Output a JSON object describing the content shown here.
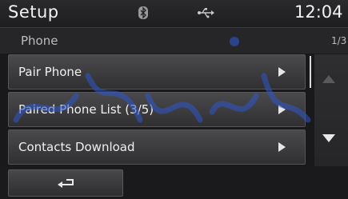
{
  "header": {
    "title": "Setup",
    "clock": "12:04",
    "bluetooth_icon": "bluetooth-icon",
    "usb_icon": "usb-icon"
  },
  "subheader": {
    "title": "Phone",
    "page_indicator": "1/3"
  },
  "menu": {
    "items": [
      {
        "label": "Pair Phone"
      },
      {
        "label": "Paired Phone List (3/5)"
      },
      {
        "label": "Contacts Download"
      }
    ]
  },
  "scroll": {
    "up_icon": "triangle-up-icon",
    "down_icon": "triangle-down-icon"
  },
  "footer": {
    "back_icon": "return-arrow-icon"
  },
  "colors": {
    "background": "#19191b",
    "button": "#3c3c3e",
    "text": "#f0f0f0"
  }
}
